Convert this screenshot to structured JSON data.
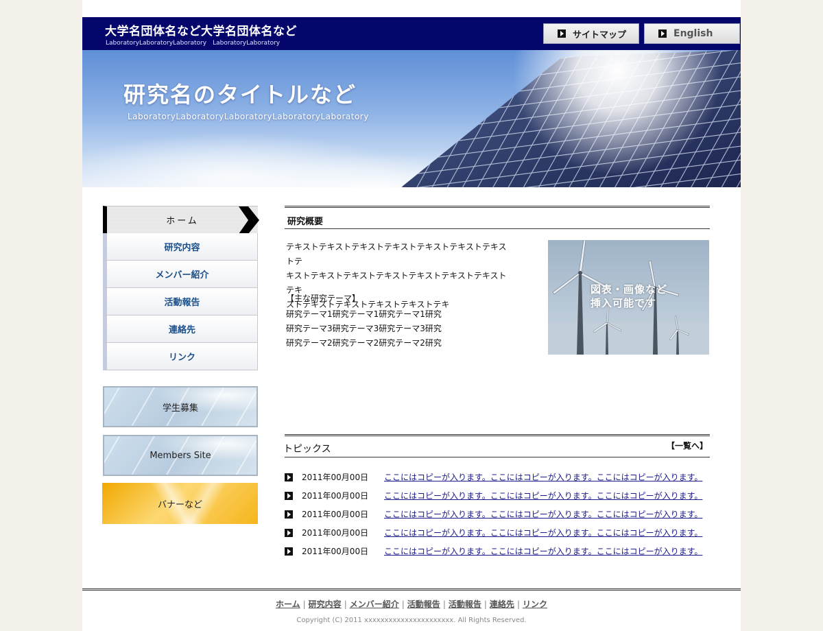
{
  "header": {
    "org_title": "大学名団体名など大学名団体名など",
    "org_subtitle": "LaboratoryLaboratoryLaboratory　LaboratoryLaboratory",
    "sitemap_label": "サイトマップ",
    "english_label": "English"
  },
  "hero": {
    "title": "研究名のタイトルなど",
    "subtitle": "LaboratoryLaboratoryLaboratoryLaboratoryLaboratory"
  },
  "nav": {
    "items": [
      {
        "label": "ホーム"
      },
      {
        "label": "研究内容"
      },
      {
        "label": "メンバー紹介"
      },
      {
        "label": "活動報告"
      },
      {
        "label": "連絡先"
      },
      {
        "label": "リンク"
      }
    ]
  },
  "banners": {
    "recruit": "学生募集",
    "members": "Members Site",
    "misc": "バナーなど"
  },
  "overview": {
    "heading": "研究概要",
    "lines": [
      "テキストテキストテキストテキストテキストテキストテキストテ",
      "キストテキストテキストテキストテキストテキストテキストテキ",
      "ストテキストテキストテキストテキストテキ"
    ],
    "theme_title": "【主な研究テーマ】",
    "themes": [
      "研究テーマ1研究テーマ1研究テーマ1研究",
      "研究テーマ3研究テーマ3研究テーマ3研究",
      "研究テーマ2研究テーマ2研究テーマ2研究"
    ],
    "image_caption_1": "図表・画像など",
    "image_caption_2": "挿入可能です"
  },
  "topics": {
    "heading": "トピックス",
    "more_label": "【一覧へ】",
    "items": [
      {
        "date": "2011年00月00日",
        "text": "ここにはコピーが入ります。ここにはコピーが入ります。ここにはコピーが入ります。"
      },
      {
        "date": "2011年00月00日",
        "text": "ここにはコピーが入ります。ここにはコピーが入ります。ここにはコピーが入ります。"
      },
      {
        "date": "2011年00月00日",
        "text": "ここにはコピーが入ります。ここにはコピーが入ります。ここにはコピーが入ります。"
      },
      {
        "date": "2011年00月00日",
        "text": "ここにはコピーが入ります。ここにはコピーが入ります。ここにはコピーが入ります。"
      },
      {
        "date": "2011年00月00日",
        "text": "ここにはコピーが入ります。ここにはコピーが入ります。ここにはコピーが入ります。"
      }
    ]
  },
  "footer": {
    "links": [
      "ホーム",
      "研究内容",
      "メンバー紹介",
      "活動報告",
      "活動報告",
      "連絡先",
      "リンク"
    ],
    "separator": "|",
    "copyright": "Copyright (C) 2011 xxxxxxxxxxxxxxxxxxxxxx. All Rights Reserved."
  },
  "colors": {
    "header_bg": "#05066b",
    "nav_text": "#1a4f8a",
    "link": "#1a1a8a"
  }
}
